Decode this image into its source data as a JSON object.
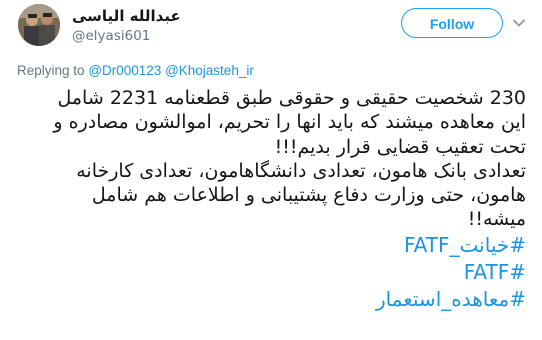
{
  "author": {
    "display_name": "عبدالله الیاسی",
    "handle": "@elyasi601"
  },
  "follow_button": {
    "label": "Follow"
  },
  "reply": {
    "prefix": "Replying to",
    "mentions": [
      "@Dr000123",
      "@Khojasteh_ir"
    ]
  },
  "tweet": {
    "lines": [
      "230 شخصیت حقیقی و حقوقی طبق قطعنامه 2231 شامل",
      "این معاهده میشند که باید انها را تحریم، اموالشون مصادره و",
      "تحت تعقیب قضایی قرار بدیم!!!",
      "تعدادی بانک هامون، تعدادی دانشگاهامون، تعدادی کارخانه",
      "هامون، حتی وزارت دفاع پشتیبانی و اطلاعات هم شامل",
      "میشه!!"
    ],
    "hashtags": [
      "#خیانت_FATF",
      "#FATF",
      "#معاهده_استعمار"
    ]
  },
  "icons": {
    "avatar": "profile-photo",
    "menu": "chevron-down-icon"
  },
  "colors": {
    "accent": "#1da1f2",
    "link": "#1b95e0",
    "secondary_text": "#657786",
    "text": "#14171a"
  }
}
